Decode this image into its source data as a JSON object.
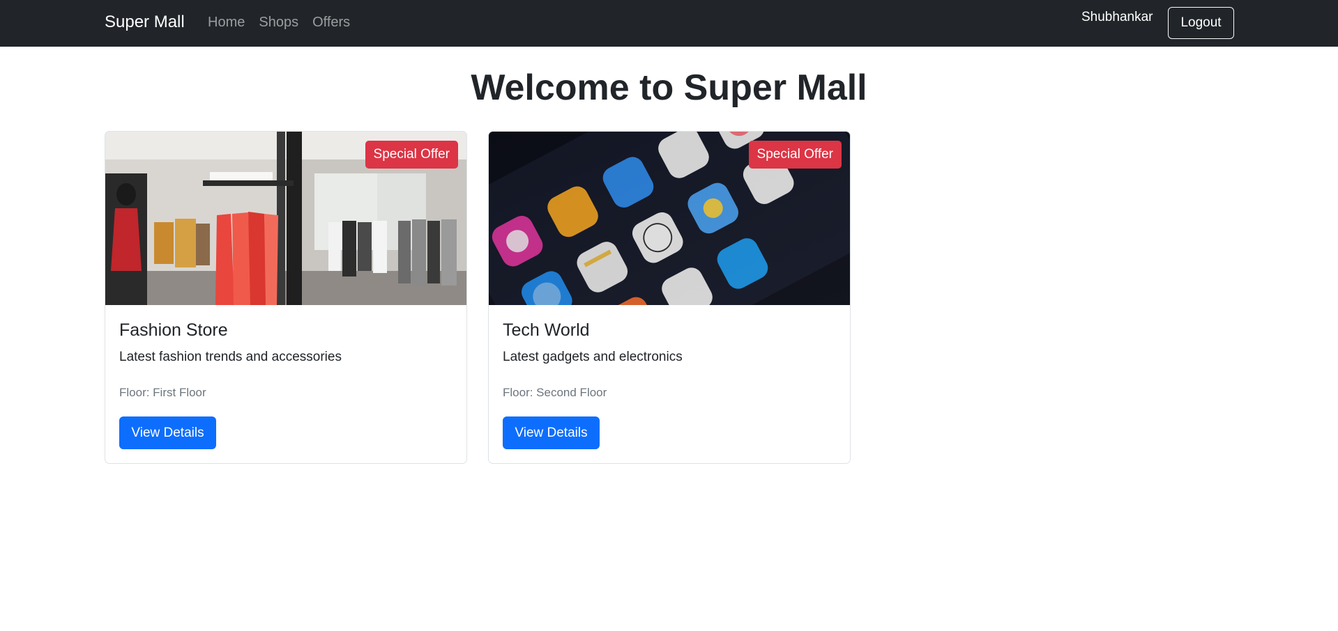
{
  "navbar": {
    "brand": "Super Mall",
    "links": [
      "Home",
      "Shops",
      "Offers"
    ],
    "user_name": "Shubhankar",
    "logout_label": "Logout"
  },
  "main": {
    "title": "Welcome to Super Mall",
    "shops": [
      {
        "badge": "Special Offer",
        "name": "Fashion Store",
        "description": "Latest fashion trends and accessories",
        "floor": "Floor: First Floor",
        "button_label": "View Details",
        "image_subject": "clothing store interior"
      },
      {
        "badge": "Special Offer",
        "name": "Tech World",
        "description": "Latest gadgets and electronics",
        "floor": "Floor: Second Floor",
        "button_label": "View Details",
        "image_subject": "smartphone app icons"
      }
    ]
  },
  "colors": {
    "navbar_bg": "#212529",
    "badge_bg": "#dc3545",
    "primary_button": "#0d6efd",
    "text_muted": "#6c757d"
  }
}
